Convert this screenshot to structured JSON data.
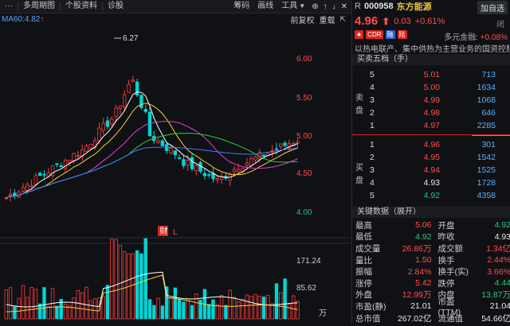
{
  "toolbar": {
    "menu_icon": "more-dots-icon",
    "items": [
      "···",
      "多周期图",
      "个股资料",
      "诊股"
    ],
    "right_items": [
      "筹码",
      "画线",
      "工具"
    ],
    "icons": [
      "add-icon",
      "arrow-up-icon",
      "arrow-down-icon",
      "close-icon"
    ]
  },
  "subbar": {
    "ma_label": "MA60:4.82",
    "ma_arrow": "↑",
    "buttons": [
      "前复权",
      "重载"
    ]
  },
  "chart": {
    "max_label": "6.27",
    "y_ticks": [
      "6.00",
      "5.50",
      "5.00",
      "4.50",
      "4.00"
    ],
    "vol_ticks": [
      "171.24",
      "85.62",
      "万"
    ],
    "badges": [
      "财",
      "L"
    ],
    "colors": {
      "up": "#ff3b3b",
      "down": "#00d5d5",
      "ma5": "#ffffff",
      "ma10": "#f5d23a",
      "ma20": "#e040d0",
      "ma30": "#2ecc40",
      "ma60": "#3b7dff"
    }
  },
  "quote": {
    "market": "R",
    "code": "000958",
    "name": "东方能源",
    "add_button": "加自选",
    "price": "4.96",
    "change": "0.03",
    "change_pct": "+0.61%",
    "close_label": "闭",
    "tags": [
      {
        "text": "★",
        "color": "#d9261c"
      },
      {
        "text": "CDR",
        "color": "#d9261c"
      },
      {
        "text": "融",
        "color": "#2b5fd9"
      },
      {
        "text": "陆",
        "color": "#d9261c"
      }
    ],
    "money_label": "多元金融:",
    "money_value": "+0.08%",
    "description": "以热电联产、集中供热为主营业务的国资控股..."
  },
  "orderbook": {
    "title": "买卖五档（手）",
    "sell_label": [
      "卖",
      "盘"
    ],
    "buy_label": [
      "买",
      "盘"
    ],
    "asks": [
      {
        "level": "5",
        "price": "5.01",
        "vol": "713",
        "color": "red"
      },
      {
        "level": "4",
        "price": "5.00",
        "vol": "1634",
        "color": "red"
      },
      {
        "level": "3",
        "price": "4.99",
        "vol": "1068",
        "color": "red"
      },
      {
        "level": "2",
        "price": "4.98",
        "vol": "646",
        "color": "red"
      },
      {
        "level": "1",
        "price": "4.97",
        "vol": "2285",
        "color": "red"
      }
    ],
    "bids": [
      {
        "level": "1",
        "price": "4.96",
        "vol": "301",
        "color": "red"
      },
      {
        "level": "2",
        "price": "4.95",
        "vol": "1542",
        "color": "red"
      },
      {
        "level": "3",
        "price": "4.94",
        "vol": "1525",
        "color": "red"
      },
      {
        "level": "4",
        "price": "4.93",
        "vol": "1728",
        "color": "white"
      },
      {
        "level": "5",
        "price": "4.92",
        "vol": "4358",
        "color": "green"
      }
    ]
  },
  "keydata": {
    "title": "关键数据（展开）",
    "rows": [
      {
        "l1": "最高",
        "v1": "5.06",
        "c1": "red",
        "l2": "开盘",
        "v2": "4.92",
        "c2": "green"
      },
      {
        "l1": "最低",
        "v1": "4.92",
        "c1": "green",
        "l2": "昨收",
        "v2": "4.93",
        "c2": "white"
      },
      {
        "l1": "成交量",
        "v1": "26.86万",
        "c1": "red",
        "l2": "成交额",
        "v2": "1.34亿",
        "c2": "red"
      },
      {
        "l1": "量比",
        "v1": "1.50",
        "c1": "red",
        "l2": "换手",
        "v2": "2.44%",
        "c2": "red"
      },
      {
        "l1": "振幅",
        "v1": "2.84%",
        "c1": "red",
        "l2": "换手(实)",
        "v2": "3.66%",
        "c2": "red"
      },
      {
        "l1": "涨停",
        "v1": "5.42",
        "c1": "red",
        "l2": "跌停",
        "v2": "4.44",
        "c2": "green"
      },
      {
        "l1": "外盘",
        "v1": "12.99万",
        "c1": "red",
        "l2": "内盘",
        "v2": "13.87万",
        "c2": "green"
      },
      {
        "l1": "市盈(静)",
        "v1": "21.01",
        "c1": "white",
        "l2": "市盈(TTM)",
        "v2": "21.04",
        "c2": "white"
      },
      {
        "l1": "总市值",
        "v1": "267.02亿",
        "c1": "white",
        "l2": "流通值",
        "v2": "54.66亿",
        "c2": "white"
      }
    ]
  }
}
